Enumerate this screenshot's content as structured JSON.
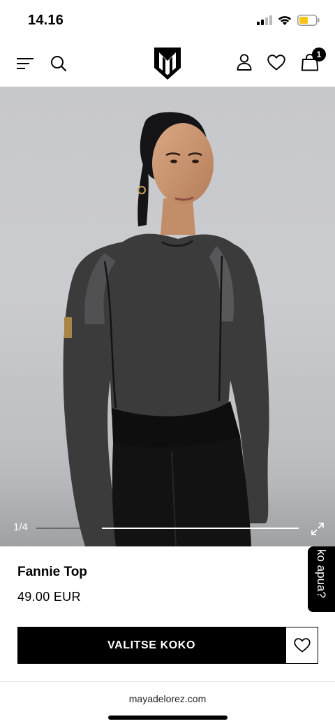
{
  "status_bar": {
    "time": "14.16",
    "icons": [
      "signal-icon",
      "wifi-icon",
      "battery-icon"
    ],
    "battery_color": "#f5c518"
  },
  "header": {
    "icons": [
      "menu-icon",
      "search-icon",
      "brand-logo",
      "account-icon",
      "heart-icon",
      "bag-icon"
    ],
    "cart_count": "1"
  },
  "gallery": {
    "counter": "1/4",
    "progress": 0.25
  },
  "product": {
    "name": "Fannie Top",
    "price": "49.00 EUR"
  },
  "help_tab": {
    "label": "ko apua?"
  },
  "actions": {
    "select_size_label": "VALITSE KOKO"
  },
  "browser": {
    "url": "mayadelorez.com"
  },
  "colors": {
    "primary": "#000000",
    "background": "#ffffff",
    "badge": "#000000"
  }
}
